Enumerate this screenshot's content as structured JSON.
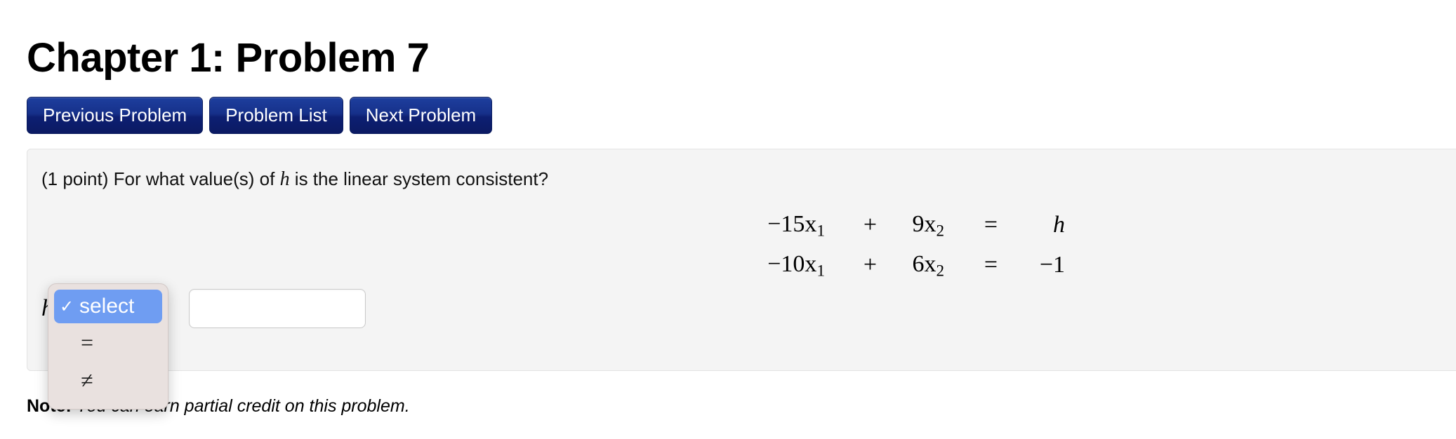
{
  "header": {
    "title": "Chapter 1: Problem 7"
  },
  "nav": {
    "buttons": [
      {
        "label": "Previous Problem",
        "name": "previous-problem-button"
      },
      {
        "label": "Problem List",
        "name": "problem-list-button"
      },
      {
        "label": "Next Problem",
        "name": "next-problem-button"
      }
    ]
  },
  "problem": {
    "points": "(1 point)",
    "statement_before_var": "(1 point) For what value(s) of ",
    "variable": "h",
    "statement_after_var": " is the linear system consistent?",
    "equations": [
      {
        "lhs": "−15x",
        "lhs_sub": "1",
        "op": "+",
        "mid": "9x",
        "mid_sub": "2",
        "rel": "=",
        "rhs": "h",
        "rhs_italic": true
      },
      {
        "lhs": "−10x",
        "lhs_sub": "1",
        "op": "+",
        "mid": "6x",
        "mid_sub": "2",
        "rel": "=",
        "rhs": "−1",
        "rhs_italic": false
      }
    ],
    "answer": {
      "label": "h",
      "select_value": "select",
      "input_value": "",
      "input_placeholder": ""
    }
  },
  "dropdown": {
    "open": true,
    "options": [
      {
        "label": "select",
        "selected": true,
        "check": "✓"
      },
      {
        "label": "=",
        "selected": false,
        "check": "✓"
      },
      {
        "label": "≠",
        "selected": false,
        "check": "✓"
      }
    ]
  },
  "note": {
    "label": "Note:",
    "text": " You can earn partial credit on this problem."
  },
  "colors": {
    "button_blue_top": "#1e3f9e",
    "button_blue_bottom": "#0b1a63",
    "panel_bg": "#f4f4f4",
    "panel_border": "#e3e3e3",
    "dropdown_bg": "#e9e1df",
    "dropdown_highlight": "#6f9df2",
    "page_bg": "#ffffff"
  }
}
